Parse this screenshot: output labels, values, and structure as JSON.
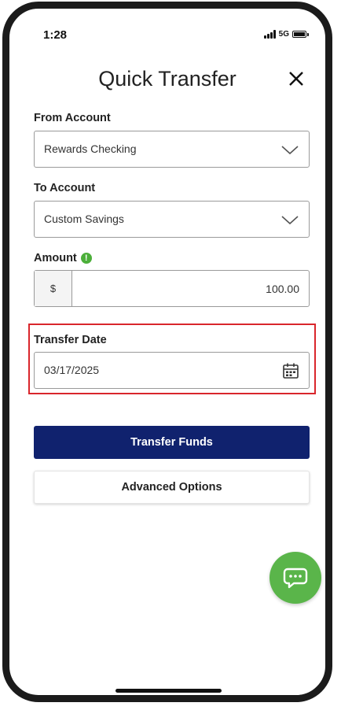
{
  "status_bar": {
    "time": "1:28",
    "network": "5G"
  },
  "header": {
    "title": "Quick Transfer",
    "close_icon": "close-icon"
  },
  "form": {
    "from_account": {
      "label": "From Account",
      "value": "Rewards Checking"
    },
    "to_account": {
      "label": "To Account",
      "value": "Custom Savings"
    },
    "amount": {
      "label": "Amount",
      "info_icon": "info-icon",
      "currency": "$",
      "value": "100.00"
    },
    "transfer_date": {
      "label": "Transfer Date",
      "value": "03/17/2025",
      "icon": "calendar-icon"
    }
  },
  "actions": {
    "primary_label": "Transfer Funds",
    "secondary_label": "Advanced Options"
  },
  "chat": {
    "icon": "chat-icon"
  },
  "colors": {
    "primary_button": "#10226e",
    "chat_fab": "#5ab54a",
    "info_icon": "#4caf3a",
    "highlight_border": "#d9262c"
  }
}
